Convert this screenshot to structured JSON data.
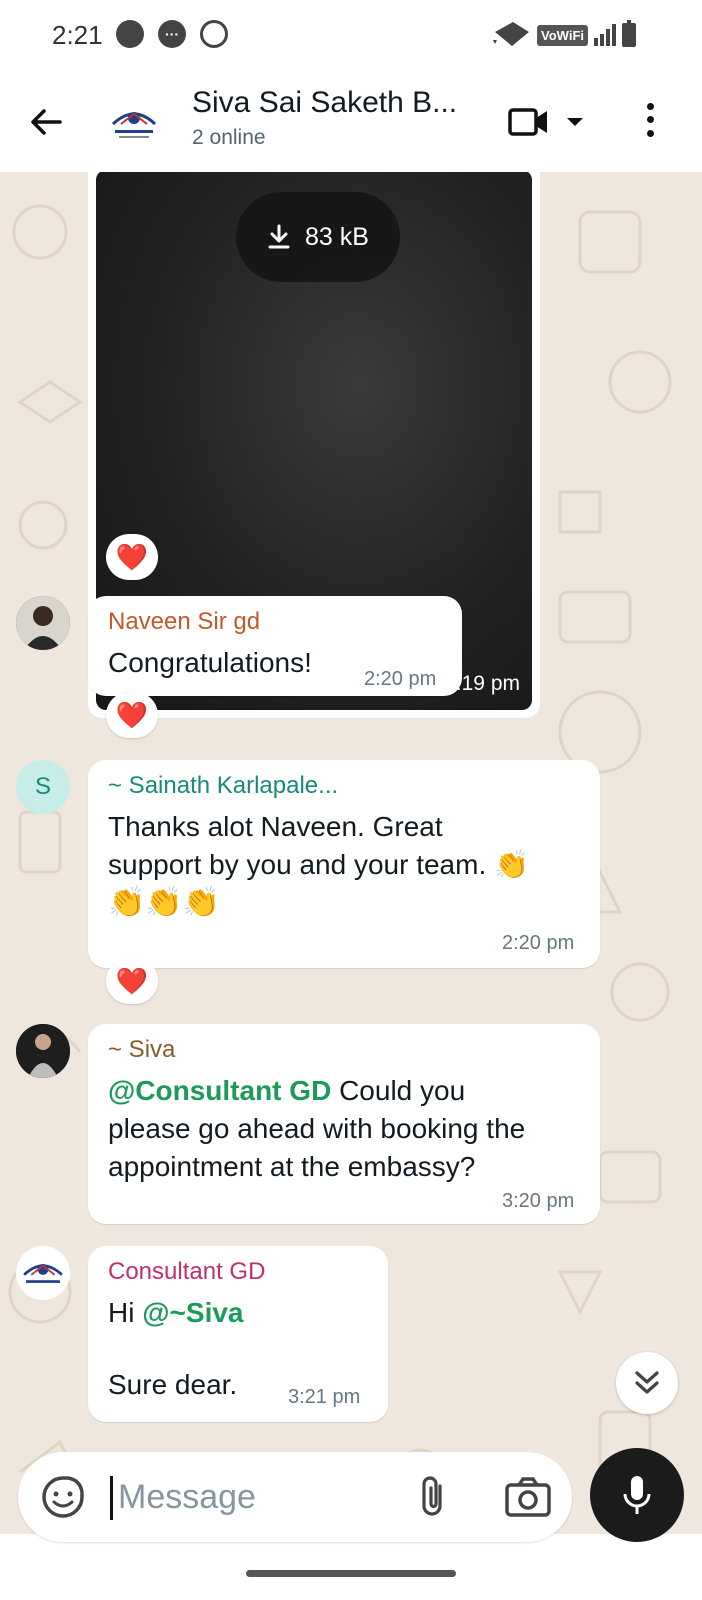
{
  "status_bar": {
    "time": "2:21",
    "network_badge": "VoWiFi"
  },
  "header": {
    "title": "Siva Sai Saketh B...",
    "subtitle": "2 online",
    "icons": [
      "back-arrow-icon",
      "group-avatar",
      "video-call-icon",
      "chevron-down-icon",
      "more-vertical-icon"
    ]
  },
  "messages": [
    {
      "type": "image",
      "download_size": "83 kB",
      "time": "2:19 pm",
      "reaction": "❤️"
    },
    {
      "type": "text",
      "sender": "Naveen Sir gd",
      "sender_color": "#c0592b",
      "text": "Congratulations!",
      "time": "2:20 pm",
      "reaction": "❤️"
    },
    {
      "type": "text",
      "sender": "~ Sainath Karlapale...",
      "sender_color": "#198a7a",
      "avatar_letter": "S",
      "text_line1": "Thanks alot Naveen. Great",
      "text_line2": "support by you and your team. 👏",
      "text_line3": "👏👏👏",
      "time": "2:20 pm",
      "reaction": "❤️"
    },
    {
      "type": "text",
      "sender": "~ Siva",
      "sender_color": "#8a5a2b",
      "mention": "@Consultant GD",
      "text_line1": " Could you",
      "text_line2": "please go ahead with booking the",
      "text_line3": "appointment at the embassy?",
      "time": "3:20 pm"
    },
    {
      "type": "text",
      "sender": "Consultant GD",
      "sender_color": "#c2306a",
      "prefix": "Hi ",
      "mention": "@~Siva",
      "text_line2": "Sure dear.",
      "time": "3:21 pm"
    }
  ],
  "input": {
    "placeholder": "Message"
  },
  "colors": {
    "wallpaper": "#efe7dd",
    "mention": "#1c9a5a",
    "mic_button": "#1b1b1b"
  }
}
